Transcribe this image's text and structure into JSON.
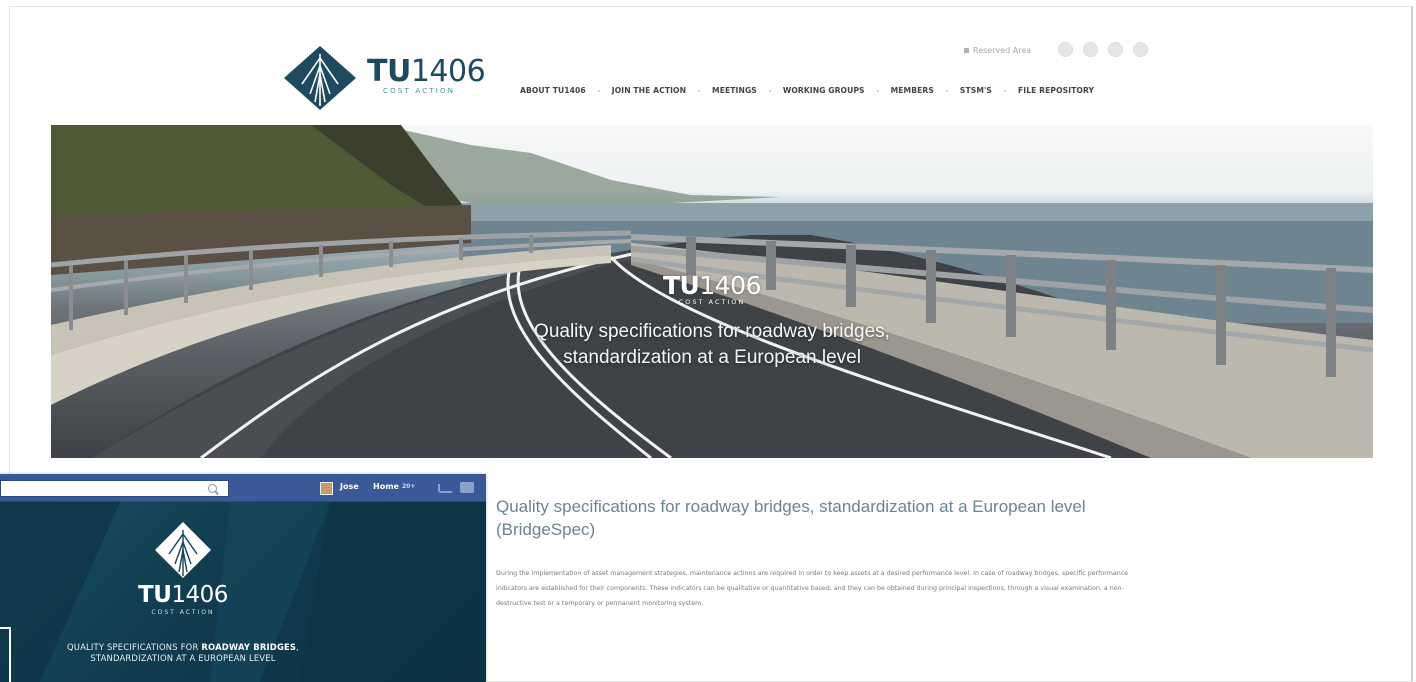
{
  "site": {
    "logo": {
      "word_bold": "TU",
      "word_light": "1406",
      "subtitle": "COST ACTION"
    },
    "top_bar": {
      "reserved_area": "Reserved Area",
      "social_icons": [
        "facebook-icon",
        "twitter-icon",
        "linkedin-icon",
        "rss-icon"
      ]
    },
    "nav": [
      {
        "label": "ABOUT TU1406"
      },
      {
        "label": "JOIN THE ACTION"
      },
      {
        "label": "MEETINGS"
      },
      {
        "label": "WORKING GROUPS"
      },
      {
        "label": "MEMBERS"
      },
      {
        "label": "STSM'S"
      },
      {
        "label": "FILE REPOSITORY"
      }
    ],
    "hero": {
      "logo_bold": "TU",
      "logo_light": "1406",
      "logo_sub": "COST ACTION",
      "tagline_line1": "Quality specifications for roadway bridges,",
      "tagline_line2": "standardization at a European level"
    },
    "content": {
      "title": "Quality specifications for roadway bridges, standardization at a European level (BridgeSpec)",
      "body": "During the implementation of asset management strategies, maintenance actions are required in order to keep assets at a desired performance level. In case of roadway bridges, specific performance indicators are established for their components. These indicators can be qualitative or quantitative based, and they can be obtained during principal inspections, through a visual examination, a non-destructive test or a temporary or permanent monitoring system."
    }
  },
  "facebook": {
    "user_name": "Jose",
    "home_label": "Home",
    "home_count": "20+",
    "cover": {
      "logo_bold": "TU",
      "logo_light": "1406",
      "logo_sub": "COST ACTION",
      "tagline_line1_pre": "QUALITY SPECIFICATIONS FOR ",
      "tagline_line1_bold": "ROADWAY BRIDGES",
      "tagline_line1_post": ",",
      "tagline_line2": "STANDARDIZATION AT A EUROPEAN LEVEL"
    }
  },
  "colors": {
    "brand_dark": "#1d4a5e",
    "brand_light": "#4a8ea8",
    "facebook_blue": "#3b5998",
    "content_title": "#6c8492"
  }
}
